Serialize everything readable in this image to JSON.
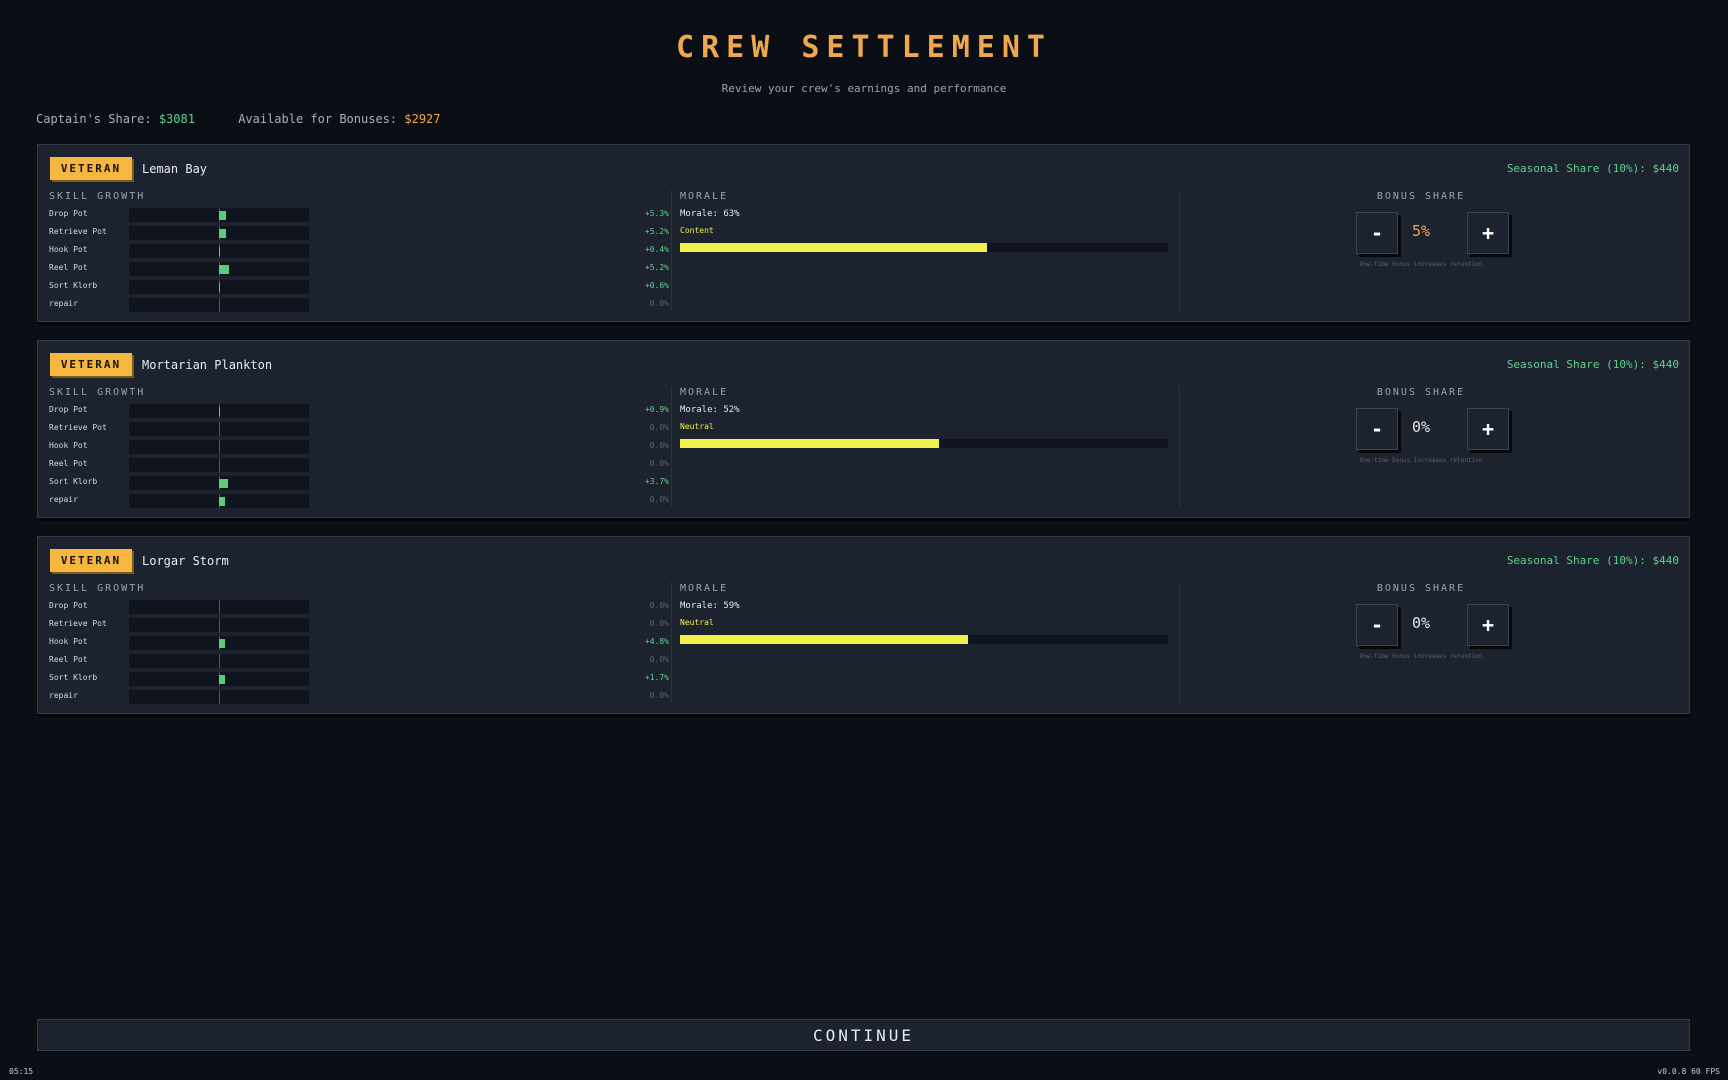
{
  "header": {
    "title": "CREW SETTLEMENT",
    "subtitle": "Review your crew's earnings and performance"
  },
  "shares": {
    "captain_label": "Captain's Share:",
    "captain_value": "$3081",
    "bonus_label": "Available for Bonuses:",
    "bonus_value": "$2927"
  },
  "labels": {
    "skill_growth": "SKILL GROWTH",
    "morale": "MORALE",
    "bonus_share": "BONUS SHARE",
    "minus": "-",
    "plus": "+",
    "hint": "One-time bonus increases retention"
  },
  "crew": [
    {
      "rank": "VETERAN",
      "name": "Leman Bay",
      "seasonal_share": "Seasonal Share (10%): $440",
      "skills": [
        {
          "name": "Drop Pot",
          "delta": "+5.3%",
          "value": 5.3
        },
        {
          "name": "Retrieve Pot",
          "delta": "+5.2%",
          "value": 5.2
        },
        {
          "name": "Hook Pot",
          "delta": "+0.4%",
          "value": 0.4
        },
        {
          "name": "Reel Pot",
          "delta": "+5.2%",
          "value": 7.2
        },
        {
          "name": "Sort Klorb",
          "delta": "+0.6%",
          "value": 0.6
        },
        {
          "name": "repair",
          "delta": "0.0%",
          "value": 0
        }
      ],
      "morale_text": "Morale: 63%",
      "morale_value": 63,
      "morale_state": "Content",
      "bonus_pct": "5%",
      "bonus_color": "#f0a850"
    },
    {
      "rank": "VETERAN",
      "name": "Mortarian Plankton",
      "seasonal_share": "Seasonal Share (10%): $440",
      "skills": [
        {
          "name": "Drop Pot",
          "delta": "+0.9%",
          "value": 0.9
        },
        {
          "name": "Retrieve Pot",
          "delta": "0.0%",
          "value": 0
        },
        {
          "name": "Hook Pot",
          "delta": "0.0%",
          "value": 0
        },
        {
          "name": "Reel Pot",
          "delta": "0.0%",
          "value": 0
        },
        {
          "name": "Sort Klorb",
          "delta": "+3.7%",
          "value": 7.0
        },
        {
          "name": "repair",
          "delta": "0.0%",
          "value": 4.5
        }
      ],
      "morale_text": "Morale: 52%",
      "morale_value": 53,
      "morale_state": "Neutral",
      "bonus_pct": "0%",
      "bonus_color": "#e6e6e6"
    },
    {
      "rank": "VETERAN",
      "name": "Lorgar Storm",
      "seasonal_share": "Seasonal Share (10%): $440",
      "skills": [
        {
          "name": "Drop Pot",
          "delta": "0.0%",
          "value": 0
        },
        {
          "name": "Retrieve Pot",
          "delta": "0.0%",
          "value": 0
        },
        {
          "name": "Hook Pot",
          "delta": "+4.8%",
          "value": 4.8
        },
        {
          "name": "Reel Pot",
          "delta": "0.0%",
          "value": 0
        },
        {
          "name": "Sort Klorb",
          "delta": "+1.7%",
          "value": 4.5
        },
        {
          "name": "repair",
          "delta": "0.0%",
          "value": 0
        }
      ],
      "morale_text": "Morale: 59%",
      "morale_value": 59,
      "morale_state": "Neutral",
      "bonus_pct": "0%",
      "bonus_color": "#e6e6e6"
    }
  ],
  "footer": {
    "continue_label": "CONTINUE",
    "clock": "05:15",
    "version": "v0.0.8  60 FPS"
  },
  "colors": {
    "accent": "#f0a850",
    "positive": "#5ed38a",
    "morale_bar": "#f2f04a",
    "badge": "#f5b740",
    "card_bg": "#1c222e"
  }
}
